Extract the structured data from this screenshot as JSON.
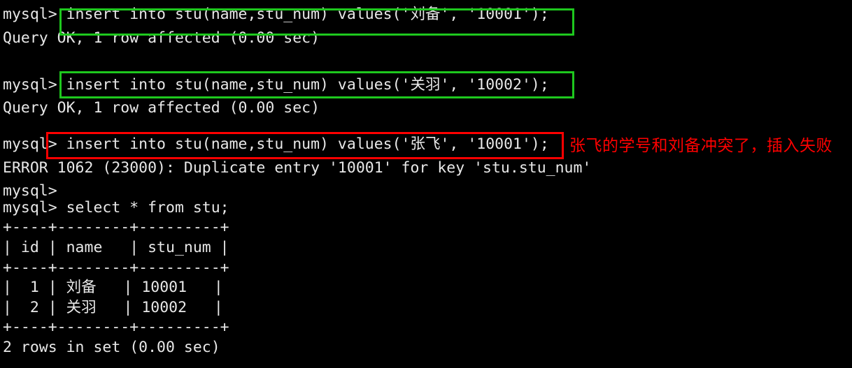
{
  "terminal": {
    "background_color": "#000000",
    "foreground_color": "#e8e8e8",
    "highlight_green": "#1ec81e",
    "highlight_red": "#ff0000",
    "prompt": "mysql>",
    "lines": [
      {
        "text": "mysql> insert into stu(name,stu_num) values('刘备', '10001');"
      },
      {
        "text": "Query OK, 1 row affected (0.00 sec)"
      },
      {
        "text": ""
      },
      {
        "text": "mysql> insert into stu(name,stu_num) values('关羽', '10002');"
      },
      {
        "text": "Query OK, 1 row affected (0.00 sec)"
      },
      {
        "text": ""
      },
      {
        "text": "mysql> insert into stu(name,stu_num) values('张飞', '10001');"
      },
      {
        "text": "ERROR 1062 (23000): Duplicate entry '10001' for key 'stu.stu_num'"
      },
      {
        "text": "mysql>"
      },
      {
        "text": "mysql> select * from stu;"
      },
      {
        "text": "+----+--------+---------+"
      },
      {
        "text": "| id | name   | stu_num |"
      },
      {
        "text": "+----+--------+---------+"
      },
      {
        "text": "|  1 | 刘备   | 10001   |"
      },
      {
        "text": "|  2 | 关羽   | 10002   |"
      },
      {
        "text": "+----+--------+---------+"
      },
      {
        "text": "2 rows in set (0.00 sec)"
      }
    ],
    "commands": {
      "insert_liubei": "insert into stu(name,stu_num) values('刘备', '10001');",
      "insert_guanyu": "insert into stu(name,stu_num) values('关羽', '10002');",
      "insert_zhangfei": "insert into stu(name,stu_num) values('张飞', '10001');",
      "select_all": "select * from stu;"
    },
    "results": {
      "ok_liubei": "Query OK, 1 row affected (0.00 sec)",
      "ok_guanyu": "Query OK, 1 row affected (0.00 sec)",
      "error_zhangfei": "ERROR 1062 (23000): Duplicate entry '10001' for key 'stu.stu_num'",
      "row_count": "2 rows in set (0.00 sec)"
    },
    "table": {
      "separator": "+----+--------+---------+",
      "header": "| id | name   | stu_num |",
      "columns": [
        "id",
        "name",
        "stu_num"
      ],
      "rows": [
        {
          "line": "|  1 | 刘备   | 10001   |",
          "id": "1",
          "name": "刘备",
          "stu_num": "10001"
        },
        {
          "line": "|  2 | 关羽   | 10002   |",
          "id": "2",
          "name": "关羽",
          "stu_num": "10002"
        }
      ]
    },
    "annotations": [
      {
        "text": "张飞的学号和刘备冲突了，插入失败",
        "color": "#ff0000"
      }
    ]
  }
}
